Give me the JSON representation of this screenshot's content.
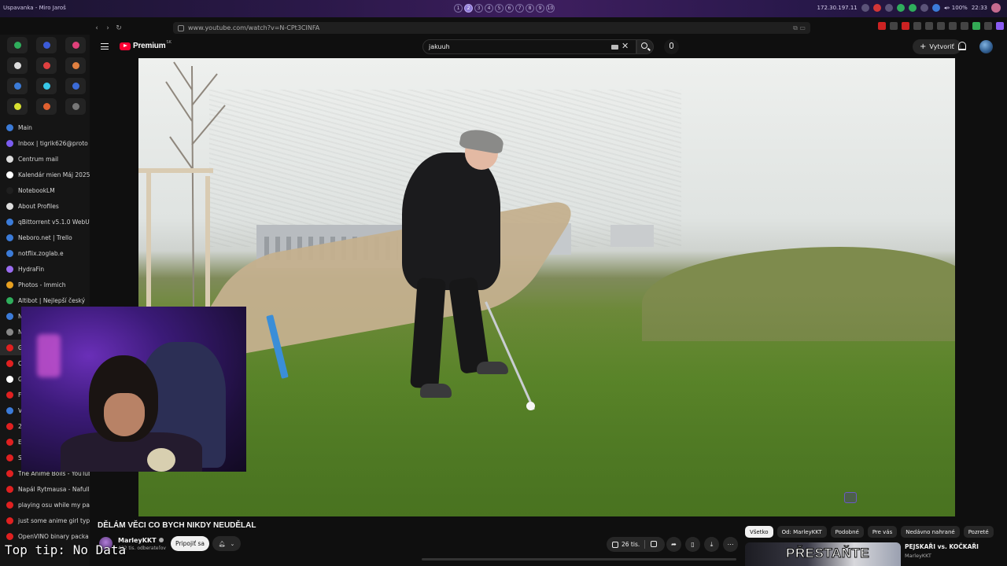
{
  "os_bar": {
    "window_title": "Uspavanka - Miro Jaroš",
    "workspaces": [
      "1",
      "2",
      "3",
      "4",
      "5",
      "6",
      "7",
      "8",
      "9",
      "10"
    ],
    "active_workspace": "2",
    "ip": "172.30.197.11",
    "volume": "◂» 100%",
    "clock": "22:33"
  },
  "browser": {
    "url": "www.youtube.com/watch?v=N-CPt3CINFA"
  },
  "sidebar": {
    "tabs": [
      {
        "label": "Main",
        "color": "#3b7bd8"
      },
      {
        "label": "Inbox | tigrik626@proto",
        "color": "#7b5cf0"
      },
      {
        "label": "Centrum mail",
        "color": "#dddddd"
      },
      {
        "label": "Kalendár mien Máj 2025",
        "color": "#ffffff"
      },
      {
        "label": "NotebookLM",
        "color": "#1f1f1f"
      },
      {
        "label": "About Profiles",
        "color": "#dddddd"
      },
      {
        "label": "qBittorrent v5.1.0 WebUI",
        "color": "#3b7bd8"
      },
      {
        "label": "Neboro.net | Trello",
        "color": "#3b7bd8"
      },
      {
        "label": "notflix.zoglab.e",
        "color": "#3b7bd8"
      },
      {
        "label": "HydraFin",
        "color": "#9a6cf0"
      },
      {
        "label": "Photos - Immich",
        "color": "#e8a020"
      },
      {
        "label": "Altibot | Nejlepší český",
        "color": "#2fae5c"
      },
      {
        "label": "N",
        "color": "#3b7bd8"
      },
      {
        "label": "N",
        "color": "#888888"
      },
      {
        "label": "G",
        "color": "#e02020"
      },
      {
        "label": "C",
        "color": "#e02020"
      },
      {
        "label": "G",
        "color": "#ffffff"
      },
      {
        "label": "F",
        "color": "#e02020"
      },
      {
        "label": "V",
        "color": "#3b7bd8"
      },
      {
        "label": "2",
        "color": "#e02020"
      },
      {
        "label": "E",
        "color": "#e02020"
      },
      {
        "label": "S",
        "color": "#e02020"
      },
      {
        "label": "The Anime Boils - YouTub",
        "color": "#e02020"
      },
      {
        "label": "Napál Rytmausa - Nafull",
        "color": "#e02020"
      },
      {
        "label": "playing osu while my par",
        "color": "#e02020"
      },
      {
        "label": "just some anime girl typi",
        "color": "#e02020"
      },
      {
        "label": "OpenVINO binary packa",
        "color": "#e02020"
      }
    ]
  },
  "masthead": {
    "logo_text": "Premium",
    "logo_region": "SK",
    "search_value": "jakuuh",
    "create_label": "Vytvoriť"
  },
  "video": {
    "title": "DĚLÁM VĚCI CO BYCH NIKDY NEUDĚLAL",
    "channel": "MarleyKKT",
    "subscribers": "432 tis. odberateľov",
    "join_label": "Pripojiť sa",
    "likes": "26 tis."
  },
  "chips": [
    "Všetko",
    "Od: MarleyKKT",
    "Podobné",
    "Pre vás",
    "Nedávno nahrané",
    "Pozreté"
  ],
  "recommended": {
    "thumb_text": "PŘESTAŇTE",
    "title": "PEJSKAŘI vs. KOČKAŘI",
    "channel": "MarleyKKT"
  },
  "overlay_tip": "Top tip: No Data"
}
